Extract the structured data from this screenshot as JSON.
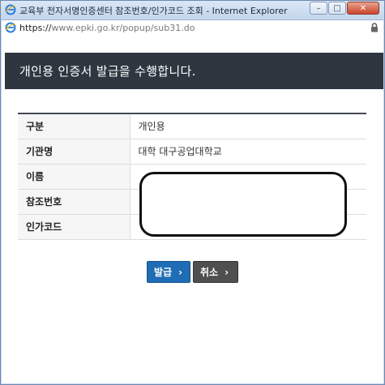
{
  "window": {
    "title": "교육부 전자서명인증센터 참조번호/인가코드 조회 - Internet Explorer",
    "controls": {
      "minimize": "–",
      "maximize": "□",
      "close": "✕"
    }
  },
  "address_bar": {
    "scheme": "https://",
    "host": "www.epki.go.kr",
    "path": "/popup/sub31.do"
  },
  "header": {
    "title": "개인용 인증서 발급을 수행합니다."
  },
  "table": {
    "rows": [
      {
        "label": "구분",
        "value": "개인용"
      },
      {
        "label": "기관명",
        "value": "대학 대구공업대학교"
      },
      {
        "label": "이름",
        "value": ""
      },
      {
        "label": "참조번호",
        "value": ""
      },
      {
        "label": "인가코드",
        "value": ""
      }
    ]
  },
  "buttons": {
    "issue_label": "발급",
    "cancel_label": "취소",
    "chevron": "›"
  },
  "colors": {
    "header_bg": "#2e3740",
    "primary_button": "#1f6db5",
    "secondary_button": "#4f4f4f"
  }
}
